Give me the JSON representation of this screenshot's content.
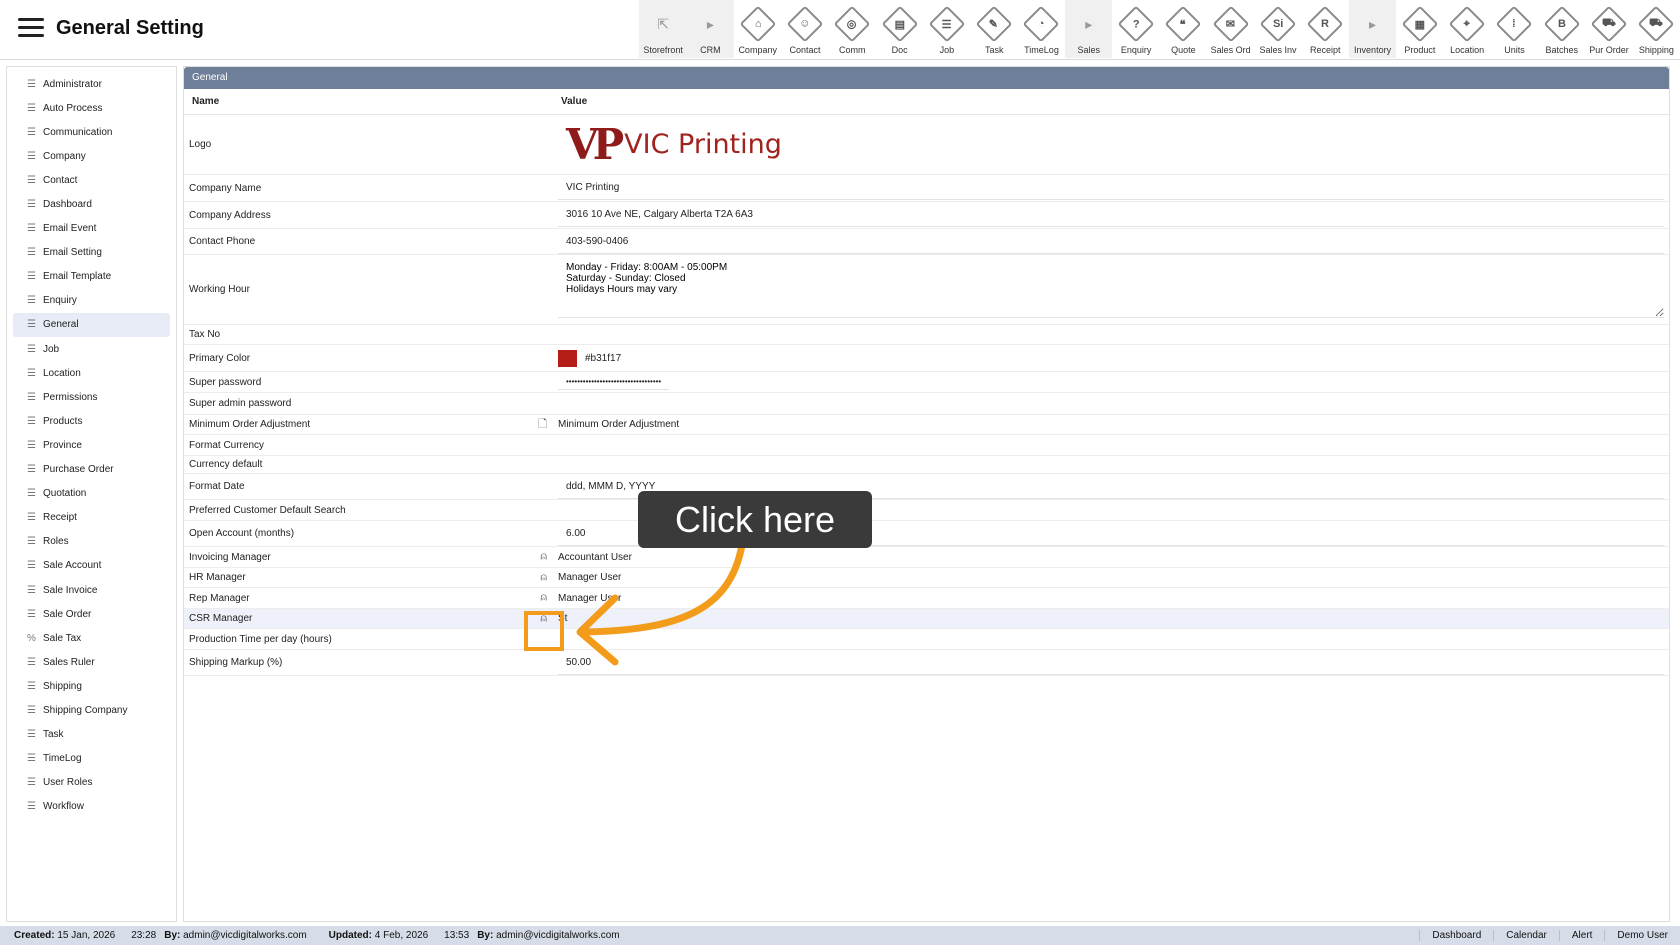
{
  "header": {
    "title": "General Setting"
  },
  "toolbar": [
    {
      "label": "Storefront",
      "icon": "external-link-icon",
      "glyph": "⇱",
      "group": true
    },
    {
      "label": "CRM",
      "icon": "chevron-right-icon",
      "glyph": "▸",
      "group": true
    },
    {
      "label": "Company",
      "icon": "company-icon",
      "glyph": "⌂",
      "group": false
    },
    {
      "label": "Contact",
      "icon": "contact-icon",
      "glyph": "☺",
      "group": false
    },
    {
      "label": "Comm",
      "icon": "comm-icon",
      "glyph": "◎",
      "group": false
    },
    {
      "label": "Doc",
      "icon": "doc-icon",
      "glyph": "▤",
      "group": false
    },
    {
      "label": "Job",
      "icon": "job-icon",
      "glyph": "☰",
      "group": false
    },
    {
      "label": "Task",
      "icon": "task-icon",
      "glyph": "✎",
      "group": false
    },
    {
      "label": "TimeLog",
      "icon": "clock-icon",
      "glyph": "◔",
      "group": false
    },
    {
      "label": "Sales",
      "icon": "chevron-right-icon",
      "glyph": "▸",
      "group": true
    },
    {
      "label": "Enquiry",
      "icon": "enquiry-icon",
      "glyph": "?",
      "group": false
    },
    {
      "label": "Quote",
      "icon": "quote-icon",
      "glyph": "❝",
      "group": false
    },
    {
      "label": "Sales Ord",
      "icon": "sales-order-icon",
      "glyph": "✉",
      "group": false
    },
    {
      "label": "Sales Inv",
      "icon": "sales-invoice-icon",
      "glyph": "Si",
      "group": false
    },
    {
      "label": "Receipt",
      "icon": "receipt-icon",
      "glyph": "R",
      "group": false
    },
    {
      "label": "Inventory",
      "icon": "chevron-right-icon",
      "glyph": "▸",
      "group": true
    },
    {
      "label": "Product",
      "icon": "product-icon",
      "glyph": "▦",
      "group": false
    },
    {
      "label": "Location",
      "icon": "location-icon",
      "glyph": "⌖",
      "group": false
    },
    {
      "label": "Units",
      "icon": "units-icon",
      "glyph": "⁞",
      "group": false
    },
    {
      "label": "Batches",
      "icon": "batches-icon",
      "glyph": "B",
      "group": false
    },
    {
      "label": "Pur Order",
      "icon": "cart-icon",
      "glyph": "⛟",
      "group": false
    },
    {
      "label": "Shipping",
      "icon": "truck-icon",
      "glyph": "⛟",
      "group": false
    }
  ],
  "sidebar": {
    "active": "General",
    "items": [
      {
        "label": "Administrator",
        "icon": "list-icon"
      },
      {
        "label": "Auto Process",
        "icon": "list-icon"
      },
      {
        "label": "Communication",
        "icon": "list-icon"
      },
      {
        "label": "Company",
        "icon": "list-icon"
      },
      {
        "label": "Contact",
        "icon": "list-icon"
      },
      {
        "label": "Dashboard",
        "icon": "list-icon"
      },
      {
        "label": "Email Event",
        "icon": "list-icon"
      },
      {
        "label": "Email Setting",
        "icon": "list-icon"
      },
      {
        "label": "Email Template",
        "icon": "list-icon"
      },
      {
        "label": "Enquiry",
        "icon": "list-icon"
      },
      {
        "label": "General",
        "icon": "list-icon"
      },
      {
        "label": "Job",
        "icon": "list-icon"
      },
      {
        "label": "Location",
        "icon": "list-icon"
      },
      {
        "label": "Permissions",
        "icon": "list-icon"
      },
      {
        "label": "Products",
        "icon": "list-icon"
      },
      {
        "label": "Province",
        "icon": "list-icon"
      },
      {
        "label": "Purchase Order",
        "icon": "list-icon"
      },
      {
        "label": "Quotation",
        "icon": "list-icon"
      },
      {
        "label": "Receipt",
        "icon": "list-icon"
      },
      {
        "label": "Roles",
        "icon": "list-icon"
      },
      {
        "label": "Sale Account",
        "icon": "list-icon"
      },
      {
        "label": "Sale Invoice",
        "icon": "list-icon"
      },
      {
        "label": "Sale Order",
        "icon": "list-icon"
      },
      {
        "label": "Sale Tax",
        "icon": "percent-icon"
      },
      {
        "label": "Sales Ruler",
        "icon": "list-icon"
      },
      {
        "label": "Shipping",
        "icon": "list-icon"
      },
      {
        "label": "Shipping Company",
        "icon": "list-icon"
      },
      {
        "label": "Task",
        "icon": "list-icon"
      },
      {
        "label": "TimeLog",
        "icon": "list-icon"
      },
      {
        "label": "User Roles",
        "icon": "list-icon"
      },
      {
        "label": "Workflow",
        "icon": "list-icon"
      }
    ]
  },
  "panel": {
    "title": "General",
    "col_name": "Name",
    "col_value": "Value",
    "logo": {
      "name": "Logo",
      "mark": "VP",
      "text": "VIC Printing"
    },
    "rows": [
      {
        "name": "Company Name",
        "value": "VIC Printing"
      },
      {
        "name": "Company Address",
        "value": "3016 10 Ave NE, Calgary Alberta T2A 6A3"
      },
      {
        "name": "Contact Phone",
        "value": "403-590-0406"
      }
    ],
    "working_hour": {
      "name": "Working Hour",
      "lines": [
        "Monday - Friday: 8:00AM - 05:00PM",
        "Saturday - Sunday: Closed",
        "Holidays Hours may vary"
      ]
    },
    "tax_no": {
      "name": "Tax No",
      "value": ""
    },
    "primary_color": {
      "name": "Primary Color",
      "value": "#b31f17",
      "swatch": "#b31f17"
    },
    "super_password": {
      "name": "Super password",
      "value": "••••••••••••••••••••••••••••••••••"
    },
    "super_admin_password": {
      "name": "Super admin password",
      "value": ""
    },
    "min_order_adj": {
      "name": "Minimum Order Adjustment",
      "value": "Minimum Order Adjustment"
    },
    "format_currency": {
      "name": "Format Currency",
      "value": ""
    },
    "currency_default": {
      "name": "Currency default",
      "value": ""
    },
    "format_date": {
      "name": "Format Date",
      "value": "ddd, MMM D, YYYY"
    },
    "pref_customer_search": {
      "name": "Preferred Customer Default Search",
      "value": ""
    },
    "open_account": {
      "name": "Open Account (months)",
      "value": "6.00"
    },
    "invoicing_manager": {
      "name": "Invoicing Manager",
      "value": "Accountant User"
    },
    "hr_manager": {
      "name": "HR Manager",
      "value": "Manager User"
    },
    "rep_manager": {
      "name": "Rep Manager",
      "value": "Manager User"
    },
    "csr_manager": {
      "name": "CSR Manager",
      "value": "St"
    },
    "production_time": {
      "name": "Production Time per day (hours)",
      "value": ""
    },
    "shipping_markup": {
      "name": "Shipping Markup (%)",
      "value": "50.00"
    }
  },
  "callout": {
    "text": "Click here",
    "color": "#f39c1b"
  },
  "footer": {
    "created_label": "Created:",
    "created_date": "15 Jan, 2026",
    "created_time": "23:28",
    "created_by_label": "By:",
    "created_by": "admin@vicdigitalworks.com",
    "updated_label": "Updated:",
    "updated_date": "4 Feb, 2026",
    "updated_time": "13:53",
    "updated_by_label": "By:",
    "updated_by": "admin@vicdigitalworks.com",
    "links": [
      "Dashboard",
      "Calendar",
      "Alert",
      "Demo User"
    ]
  }
}
